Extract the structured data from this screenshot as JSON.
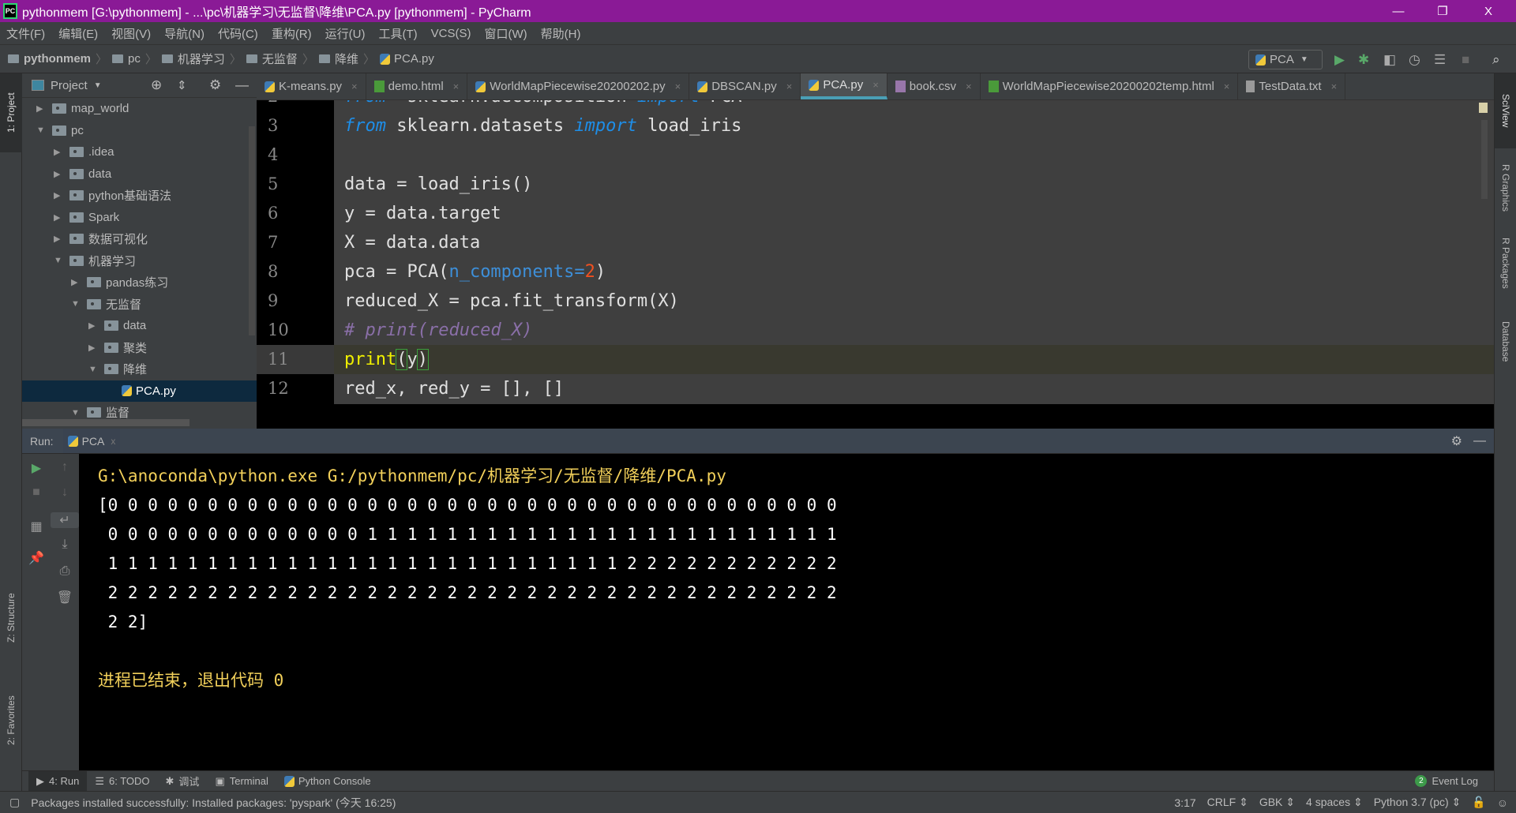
{
  "window": {
    "title": "pythonmem [G:\\pythonmem] - ...\\pc\\机器学习\\无监督\\降维\\PCA.py [pythonmem] - PyCharm",
    "app_icon": "PC",
    "minimize": "—",
    "restore": "❐",
    "close": "X"
  },
  "menu": [
    "文件(F)",
    "编辑(E)",
    "视图(V)",
    "导航(N)",
    "代码(C)",
    "重构(R)",
    "运行(U)",
    "工具(T)",
    "VCS(S)",
    "窗口(W)",
    "帮助(H)"
  ],
  "breadcrumb": [
    "pythonmem",
    "pc",
    "机器学习",
    "无监督",
    "降维",
    "PCA.py"
  ],
  "toolbar": {
    "run_config": "PCA",
    "icons": [
      "run-icon",
      "debug-icon",
      "coverage-icon",
      "profile-icon",
      "concurrency-icon",
      "stop-icon",
      "search-icon"
    ]
  },
  "left_stripe": {
    "project": "1: Project",
    "structure": "Z: Structure",
    "favorites": "2: Favorites"
  },
  "project_panel": {
    "title": "Project",
    "tree": [
      {
        "label": "map_world",
        "depth": 0,
        "expanded": false
      },
      {
        "label": "pc",
        "depth": 0,
        "expanded": true
      },
      {
        "label": ".idea",
        "depth": 1,
        "expanded": false
      },
      {
        "label": "data",
        "depth": 1,
        "expanded": false
      },
      {
        "label": "python基础语法",
        "depth": 1,
        "expanded": false
      },
      {
        "label": "Spark",
        "depth": 1,
        "expanded": false
      },
      {
        "label": "数据可视化",
        "depth": 1,
        "expanded": false
      },
      {
        "label": "机器学习",
        "depth": 1,
        "expanded": true
      },
      {
        "label": "pandas练习",
        "depth": 2,
        "expanded": false
      },
      {
        "label": "无监督",
        "depth": 2,
        "expanded": true
      },
      {
        "label": "data",
        "depth": 3,
        "expanded": false
      },
      {
        "label": "聚类",
        "depth": 3,
        "expanded": false
      },
      {
        "label": "降维",
        "depth": 3,
        "expanded": true
      },
      {
        "label": "PCA.py",
        "depth": 4,
        "file": true,
        "selected": true
      },
      {
        "label": "监督",
        "depth": 2,
        "expanded": true
      }
    ]
  },
  "tabs": [
    {
      "label": "K-means.py",
      "type": "py"
    },
    {
      "label": "demo.html",
      "type": "html"
    },
    {
      "label": "WorldMapPiecewise20200202.py",
      "type": "py"
    },
    {
      "label": "DBSCAN.py",
      "type": "py"
    },
    {
      "label": "PCA.py",
      "type": "py",
      "active": true
    },
    {
      "label": "book.csv",
      "type": "csv"
    },
    {
      "label": "WorldMapPiecewise20200202temp.html",
      "type": "html"
    },
    {
      "label": "TestData.txt",
      "type": "txt"
    }
  ],
  "editor": {
    "lines": [
      {
        "n": "2",
        "tokens": [
          [
            "kw",
            "from"
          ],
          [
            "",
            "  sklearn.decomposition "
          ],
          [
            "kw",
            "import"
          ],
          [
            "",
            " PCA"
          ]
        ],
        "partial": true
      },
      {
        "n": "3",
        "tokens": [
          [
            "kw",
            "from"
          ],
          [
            "",
            " sklearn.datasets "
          ],
          [
            "kw",
            "import"
          ],
          [
            "",
            " load_iris"
          ]
        ]
      },
      {
        "n": "4",
        "tokens": []
      },
      {
        "n": "5",
        "tokens": [
          [
            "",
            "data = load_iris()"
          ]
        ]
      },
      {
        "n": "6",
        "tokens": [
          [
            "",
            "y = data.target"
          ]
        ]
      },
      {
        "n": "7",
        "tokens": [
          [
            "",
            "X = data.data"
          ]
        ]
      },
      {
        "n": "8",
        "tokens": [
          [
            "",
            "pca = PCA("
          ],
          [
            "param",
            "n_components="
          ],
          [
            "num",
            "2"
          ],
          [
            "",
            ")"
          ]
        ]
      },
      {
        "n": "9",
        "tokens": [
          [
            "",
            "reduced_X = pca.fit_transform(X)"
          ]
        ]
      },
      {
        "n": "10",
        "tokens": [
          [
            "cmt",
            "# print(reduced_X)"
          ]
        ]
      },
      {
        "n": "11",
        "tokens": [
          [
            "fn",
            "print"
          ],
          [
            "brace",
            "("
          ],
          [
            "",
            "y"
          ],
          [
            "brace",
            ")"
          ]
        ],
        "current": true
      },
      {
        "n": "12",
        "tokens": [
          [
            "",
            "red_x, red_y = [], []"
          ]
        ]
      }
    ]
  },
  "run": {
    "label": "Run:",
    "tab": "PCA",
    "output": [
      {
        "text": "G:\\anoconda\\python.exe G:/pythonmem/pc/机器学习/无监督/降维/PCA.py",
        "style": "yellow"
      },
      {
        "text": "[0 0 0 0 0 0 0 0 0 0 0 0 0 0 0 0 0 0 0 0 0 0 0 0 0 0 0 0 0 0 0 0 0 0 0 0 0",
        "style": "white"
      },
      {
        "text": " 0 0 0 0 0 0 0 0 0 0 0 0 0 1 1 1 1 1 1 1 1 1 1 1 1 1 1 1 1 1 1 1 1 1 1 1 1",
        "style": "white"
      },
      {
        "text": " 1 1 1 1 1 1 1 1 1 1 1 1 1 1 1 1 1 1 1 1 1 1 1 1 1 1 2 2 2 2 2 2 2 2 2 2 2",
        "style": "white"
      },
      {
        "text": " 2 2 2 2 2 2 2 2 2 2 2 2 2 2 2 2 2 2 2 2 2 2 2 2 2 2 2 2 2 2 2 2 2 2 2 2 2",
        "style": "white"
      },
      {
        "text": " 2 2]",
        "style": "white"
      },
      {
        "text": "",
        "style": "white"
      },
      {
        "text": "进程已结束，退出代码 0",
        "style": "yellow"
      }
    ]
  },
  "right_stripe": [
    "SciView",
    "R Graphics",
    "R Packages",
    "Database"
  ],
  "bottom_tools": [
    {
      "label": "4: Run",
      "active": true
    },
    {
      "label": "6: TODO"
    },
    {
      "label": "调试"
    },
    {
      "label": "Terminal"
    },
    {
      "label": "Python Console"
    }
  ],
  "event_log": {
    "label": "Event Log",
    "count": "2"
  },
  "status": {
    "message": "Packages installed successfully: Installed packages: 'pyspark' (今天 16:25)",
    "position": "3:17",
    "line_sep": "CRLF",
    "encoding": "GBK",
    "indent": "4 spaces",
    "interpreter": "Python 3.7 (pc)"
  }
}
